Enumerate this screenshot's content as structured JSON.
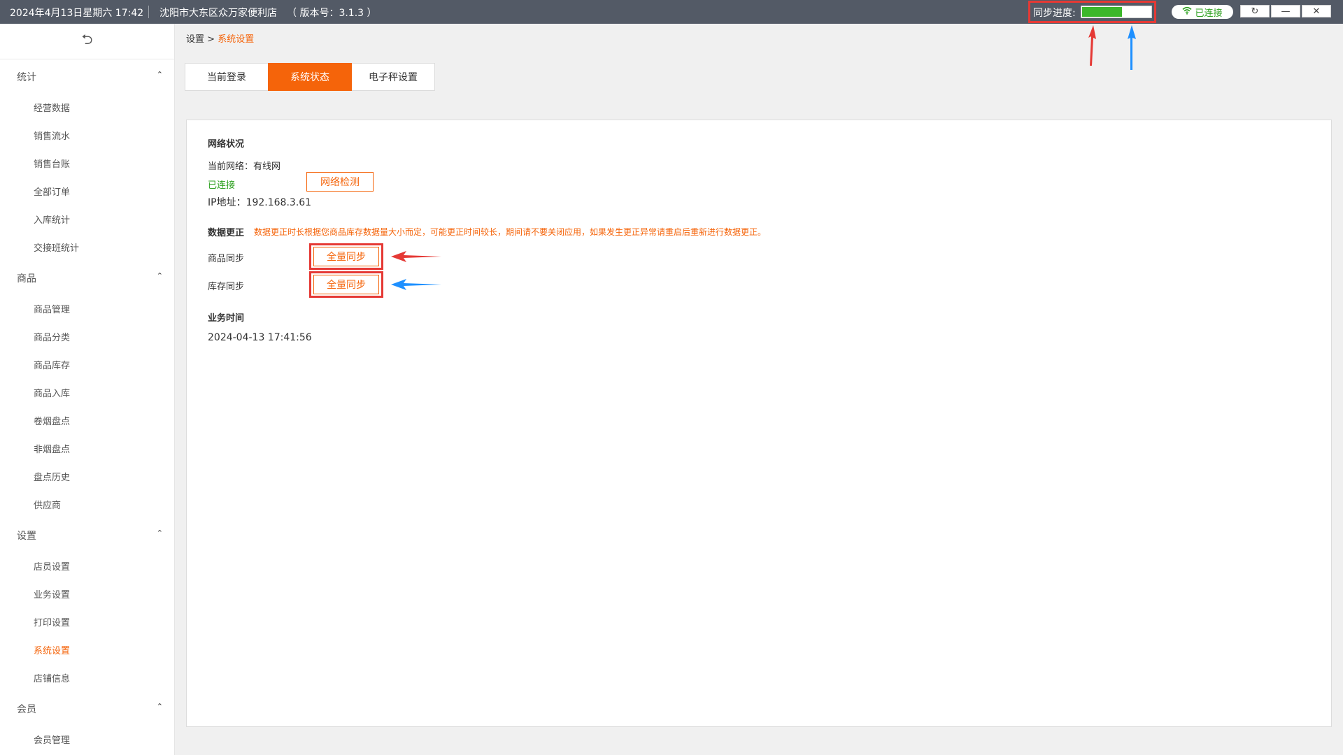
{
  "topbar": {
    "datetime": "2024年4月13日星期六 17:42",
    "store_name": "沈阳市大东区众万家便利店",
    "version": "（ 版本号：3.1.3 ）",
    "sync_label": "同步进度:",
    "sync_progress": 0.58,
    "sync_fill_color": "#3cb72b",
    "connection_status": "已连接",
    "connection_icon": "wifi-icon",
    "window_buttons": [
      "refresh-icon",
      "minimize-icon",
      "close-icon"
    ]
  },
  "sidebar": {
    "collapse_icon": "collapse-icon",
    "groups": [
      {
        "label": "统计",
        "items": [
          "经营数据",
          "销售流水",
          "销售台账",
          "全部订单",
          "入库统计",
          "交接班统计"
        ]
      },
      {
        "label": "商品",
        "items": [
          "商品管理",
          "商品分类",
          "商品库存",
          "商品入库",
          "卷烟盘点",
          "非烟盘点",
          "盘点历史",
          "供应商"
        ]
      },
      {
        "label": "设置",
        "items": [
          "店员设置",
          "业务设置",
          "打印设置",
          "系统设置",
          "店铺信息"
        ]
      },
      {
        "label": "会员",
        "items": [
          "会员管理"
        ]
      }
    ],
    "active_item": "系统设置"
  },
  "breadcrumb": {
    "root": "设置",
    "separator": ">",
    "current": "系统设置"
  },
  "tabs": [
    "当前登录",
    "系统状态",
    "电子秤设置"
  ],
  "active_tab": "系统状态",
  "network": {
    "title": "网络状况",
    "current_network": "当前网络：有线网",
    "status": "已连接",
    "check_button": "网络检测",
    "ip": "IP地址：192.168.3.61"
  },
  "data_correction": {
    "title": "数据更正",
    "note": "数据更正时长根据您商品库存数据量大小而定，可能更正时间较长，期间请不要关闭应用，如果发生更正异常请重启后重新进行数据更正。",
    "rows": [
      {
        "label": "商品同步",
        "button": "全量同步"
      },
      {
        "label": "库存同步",
        "button": "全量同步"
      }
    ]
  },
  "business_time": {
    "title": "业务时间",
    "value": "2024-04-13 17:41:56"
  },
  "colors": {
    "accent": "#f5640a",
    "topbar_bg": "#535a66",
    "highlight_red": "#e53935",
    "annotation_blue": "#1e90ff",
    "connected_green": "#2ea121"
  }
}
